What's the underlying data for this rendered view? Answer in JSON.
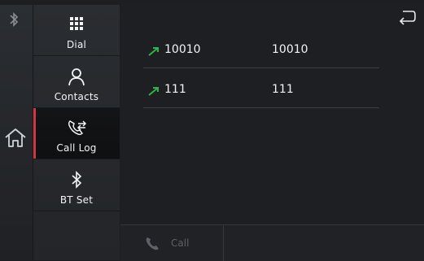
{
  "colors": {
    "accent_red": "#d6343f",
    "outgoing_arrow": "#2fb34a",
    "disabled_text": "#5e6166"
  },
  "menu": {
    "items": [
      {
        "label": "Dial",
        "icon": "dialpad-icon"
      },
      {
        "label": "Contacts",
        "icon": "person-icon"
      },
      {
        "label": "Call Log",
        "icon": "call-log-icon",
        "active": true
      },
      {
        "label": "BT Set",
        "icon": "bluetooth-icon"
      }
    ]
  },
  "rail": {
    "icons": [
      "bluetooth-status-icon",
      "home-icon"
    ]
  },
  "call_log": {
    "entries": [
      {
        "number": "10010",
        "name": "10010",
        "direction": "outgoing"
      },
      {
        "number": "111",
        "name": "111",
        "direction": "outgoing"
      }
    ]
  },
  "bottom": {
    "call_label": "Call"
  }
}
